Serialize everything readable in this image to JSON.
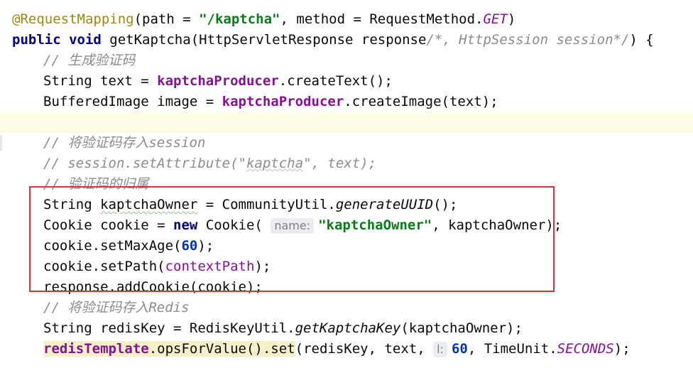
{
  "editor": {
    "lines": [
      {
        "segments": [
          {
            "cls": "ann",
            "t": "@RequestMapping"
          },
          {
            "t": "(path = "
          },
          {
            "cls": "str",
            "t": "\"/kaptcha\""
          },
          {
            "t": ", method = RequestMethod."
          },
          {
            "cls": "stat",
            "t": "GET"
          },
          {
            "t": ")"
          }
        ]
      },
      {
        "segments": [
          {
            "cls": "kw2",
            "t": "public"
          },
          {
            "t": " "
          },
          {
            "cls": "kw2",
            "t": "void"
          },
          {
            "t": " getKaptcha(HttpServletResponse response"
          },
          {
            "cls": "cmt",
            "t": "/*, HttpSession session*/"
          },
          {
            "t": ") {"
          }
        ]
      },
      {
        "indent": 1,
        "segments": [
          {
            "cls": "cmt",
            "t": "// 生成验证码"
          }
        ]
      },
      {
        "indent": 1,
        "segments": [
          {
            "t": "String text = "
          },
          {
            "cls": "fld",
            "t": "kaptchaProducer"
          },
          {
            "t": ".createText();"
          }
        ]
      },
      {
        "indent": 1,
        "segments": [
          {
            "t": "BufferedImage image = "
          },
          {
            "cls": "fld",
            "t": "kaptchaProducer"
          },
          {
            "t": ".createImage(text);"
          }
        ]
      },
      {
        "current": true,
        "segments": []
      },
      {
        "indent": 1,
        "segments": [
          {
            "cls": "cmt",
            "t": "// 将验证码存入session"
          }
        ]
      },
      {
        "indent": 1,
        "segments": [
          {
            "cls": "cmt",
            "t": "// session.setAttribute(\""
          },
          {
            "cls": "cmts",
            "t": "kaptcha"
          },
          {
            "cls": "cmt",
            "t": "\", text);"
          }
        ]
      },
      {
        "indent": 1,
        "segments": [
          {
            "cls": "cmt",
            "t": "// 验证码的归属"
          }
        ]
      },
      {
        "indent": 1,
        "segments": [
          {
            "t": "String "
          },
          {
            "cls": "typo",
            "t": "kaptchaOwner"
          },
          {
            "t": " = CommunityUtil."
          },
          {
            "cls": "statm",
            "t": "generateUUID"
          },
          {
            "t": "();"
          }
        ]
      },
      {
        "indent": 1,
        "segments": [
          {
            "t": "Cookie cookie = "
          },
          {
            "cls": "kw2",
            "t": "new"
          },
          {
            "t": " Cookie( "
          },
          {
            "cls": "hint",
            "t": "name:"
          },
          {
            "cls": "str",
            "t": "\"kaptchaOwner\""
          },
          {
            "t": ", kaptchaOwner);"
          }
        ]
      },
      {
        "indent": 1,
        "segments": [
          {
            "t": "cookie.setMaxAge("
          },
          {
            "cls": "kw",
            "t": "60"
          },
          {
            "t": ");"
          }
        ]
      },
      {
        "indent": 1,
        "segments": [
          {
            "t": "cookie.setPath("
          },
          {
            "cls": "fldp",
            "t": "contextPath"
          },
          {
            "t": ");"
          }
        ]
      },
      {
        "indent": 1,
        "segments": [
          {
            "t": "response.addCookie(cookie);"
          }
        ]
      },
      {
        "indent": 1,
        "segments": [
          {
            "cls": "cmt",
            "t": "// 将验证码存入Redis"
          }
        ]
      },
      {
        "indent": 1,
        "segments": [
          {
            "t": "String redisKey = RedisKeyUtil."
          },
          {
            "cls": "statm",
            "t": "getKaptchaKey"
          },
          {
            "t": "(kaptchaOwner);"
          }
        ]
      },
      {
        "indent": 1,
        "segments": [
          {
            "cls": "hl",
            "parts": [
              {
                "cls": "fld",
                "t": "redisTemplate"
              },
              {
                "t": ".opsForValue().set"
              }
            ]
          },
          {
            "t": "(redisKey, text, "
          },
          {
            "cls": "hint",
            "t": "l:"
          },
          {
            "cls": "kw",
            "t": "60"
          },
          {
            "t": ", TimeUnit."
          },
          {
            "cls": "stat",
            "t": "SECONDS"
          },
          {
            "t": ");"
          }
        ]
      }
    ]
  },
  "colors": {
    "annotation": "#9e880d",
    "string": "#067d17",
    "keyword": "#000080",
    "field": "#871094",
    "comment": "#8c8c8c",
    "highlight_box": "#e3302c",
    "current_line": "#fdfae6"
  }
}
